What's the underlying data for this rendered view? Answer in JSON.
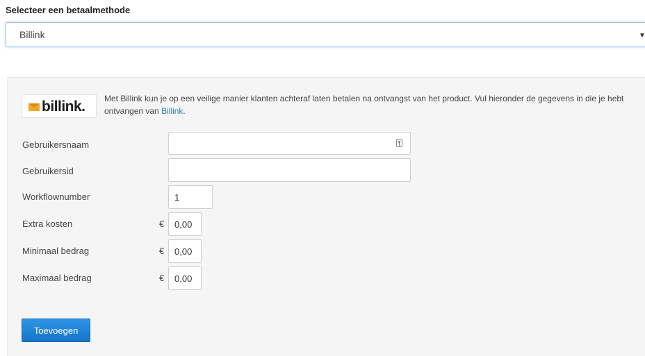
{
  "payment_select": {
    "label": "Selecteer een betaalmethode",
    "value": "Billink",
    "caret_icon": "caret-down-icon"
  },
  "provider": {
    "logo_text": "billink.",
    "logo_icon": "envelope-icon",
    "logo_color": "#f5a623",
    "intro_text": "Met Billink kun je op een veilige manier klanten achteraf laten betalen na ontvangst van het product. Vul hieronder de gegevens in die je hebt ontvangen van ",
    "intro_link": "Billink",
    "intro_end": "."
  },
  "form": {
    "username": {
      "label": "Gebruikersnaam",
      "value": ""
    },
    "userid": {
      "label": "Gebruikersid",
      "value": ""
    },
    "workflow": {
      "label": "Workflownumber",
      "value": "1"
    },
    "extra_costs": {
      "label": "Extra kosten",
      "currency": "€",
      "value": "0,00"
    },
    "min_amount": {
      "label": "Minimaal bedrag",
      "currency": "€",
      "value": "0,00"
    },
    "max_amount": {
      "label": "Maximaal bedrag",
      "currency": "€",
      "value": "0,00"
    }
  },
  "actions": {
    "add_label": "Toevoegen",
    "button_color": "#1f85d9"
  }
}
